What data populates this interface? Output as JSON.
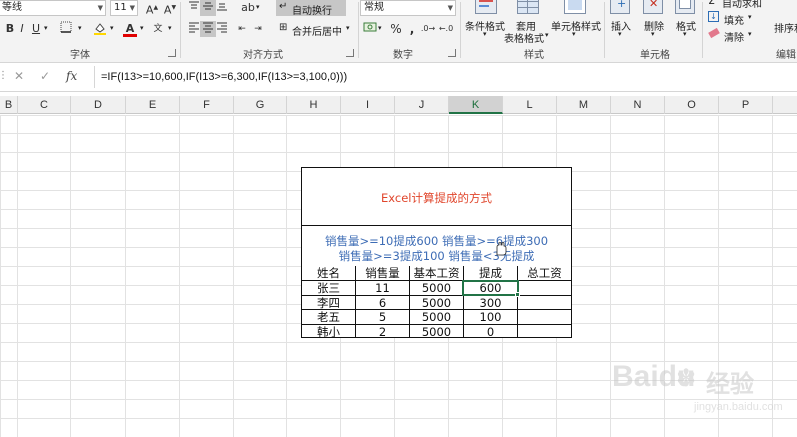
{
  "ribbon": {
    "font_name": "等线",
    "font_size": "11",
    "wrap_text": "自动换行",
    "merge_center": "合并后居中",
    "number_format": "常规",
    "percent": "%",
    "comma": ",",
    "conditional_format": "条件格式",
    "table_format_line1": "套用",
    "table_format_line2": "表格格式",
    "cell_style": "单元格样式",
    "insert": "插入",
    "delete": "删除",
    "format": "格式",
    "autosum": "自动求和",
    "fill": "填充",
    "clear": "清除",
    "sort_filter": "排序和",
    "groups": {
      "font": "字体",
      "alignment": "对齐方式",
      "number": "数字",
      "styles": "样式",
      "cells": "单元格",
      "editing": "编辑"
    }
  },
  "formula_bar": {
    "formula": "=IF(I13>=10,600,IF(I13>=6,300,IF(I13>=3,100,0)))"
  },
  "columns": [
    "B",
    "C",
    "D",
    "E",
    "F",
    "G",
    "H",
    "I",
    "J",
    "K",
    "L",
    "M",
    "N",
    "O",
    "P"
  ],
  "active_column": "K",
  "sheet": {
    "title": "Excel计算提成的方式",
    "note_line1": "销售量>=10提成600  销售量>=6提成300",
    "note_line2": "销售量>=3提成100  销售量<3无提成",
    "headers": [
      "姓名",
      "销售量",
      "基本工资",
      "提成",
      "总工资"
    ],
    "rows": [
      [
        "张三",
        "11",
        "5000",
        "600",
        ""
      ],
      [
        "李四",
        "6",
        "5000",
        "300",
        ""
      ],
      [
        "老五",
        "5",
        "5000",
        "100",
        ""
      ],
      [
        "韩小",
        "2",
        "5000",
        "0",
        ""
      ]
    ]
  },
  "watermark": {
    "brand": "Baidu",
    "brand_cn": "经验",
    "url": "jingyan.baidu.com"
  }
}
